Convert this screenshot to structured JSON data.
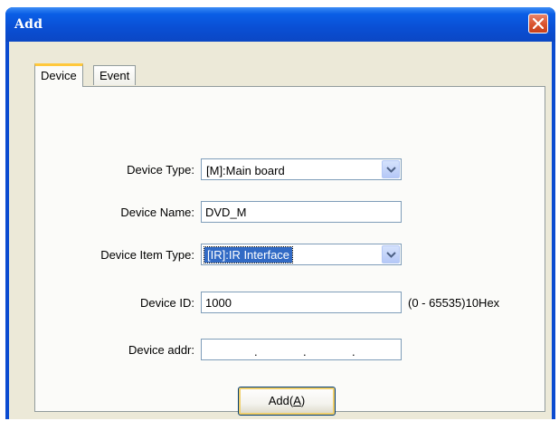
{
  "window": {
    "title": "Add"
  },
  "tabs": [
    {
      "label": "Device",
      "active": true
    },
    {
      "label": "Event",
      "active": false
    }
  ],
  "form": {
    "device_type": {
      "label": "Device Type:",
      "value": "[M]:Main board"
    },
    "device_name": {
      "label": "Device Name:",
      "value": "DVD_M"
    },
    "device_item_type": {
      "label": "Device Item Type:",
      "value": "[IR]:IR Interface"
    },
    "device_id": {
      "label": "Device ID:",
      "value": "1000",
      "hint": "(0 - 65535)10Hex"
    },
    "device_addr": {
      "label": "Device addr:",
      "dot": "."
    }
  },
  "buttons": {
    "add_label": "Add(",
    "add_accel": "A",
    "add_close": ")"
  },
  "colors": {
    "titlebar": "#0a4fd4",
    "client_bg": "#ece9d8",
    "close_button": "#d9532d",
    "selection": "#316ac5"
  },
  "icons": {
    "close": "close-icon",
    "dropdown": "chevron-down-icon"
  }
}
